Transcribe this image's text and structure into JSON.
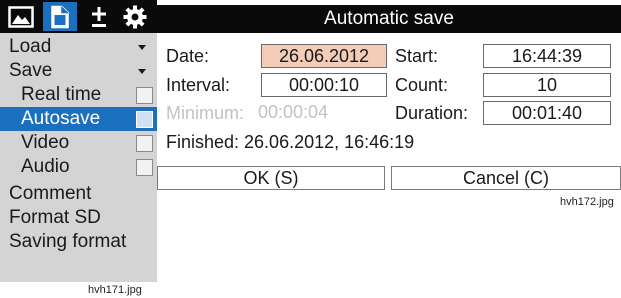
{
  "toolbar": {
    "tools": [
      {
        "icon": "image-icon"
      },
      {
        "icon": "document-icon",
        "active": true
      },
      {
        "icon": "plus-minus-icon"
      },
      {
        "icon": "gear-icon"
      }
    ]
  },
  "menu": {
    "load": "Load",
    "save": "Save",
    "realtime": "Real time",
    "autosave": "Autosave",
    "video": "Video",
    "audio": "Audio",
    "comment": "Comment",
    "format_sd": "Format SD",
    "saving_format": "Saving format"
  },
  "captions": {
    "left": "hvh171.jpg",
    "right": "hvh172.jpg"
  },
  "dialog": {
    "title": "Automatic save",
    "date_label": "Date:",
    "date_value": "26.06.2012",
    "start_label": "Start:",
    "start_value": "16:44:39",
    "interval_label": "Interval:",
    "interval_value": "00:00:10",
    "count_label": "Count:",
    "count_value": "10",
    "minimum_label": "Minimum:",
    "minimum_value": "00:00:04",
    "duration_label": "Duration:",
    "duration_value": "00:01:40",
    "finished_text": "Finished: 26.06.2012, 16:46:19",
    "ok_label": "OK (S)",
    "cancel_label": "Cancel (C)"
  },
  "colors": {
    "selection": "#1a6fbf",
    "focused_field": "#f3cdb8",
    "panel_bg": "#d4d4d4",
    "titlebar": "#0a0a0a"
  }
}
